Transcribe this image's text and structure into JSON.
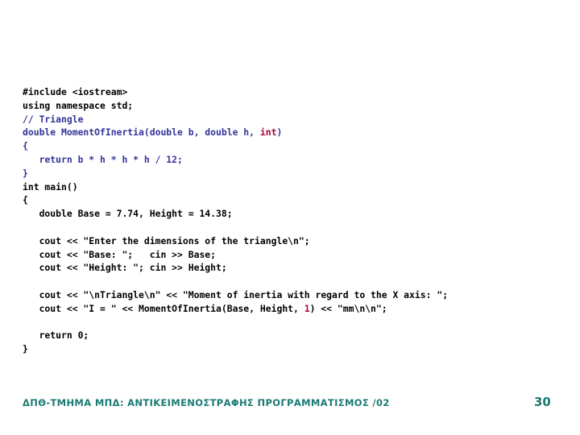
{
  "slide": {
    "background_color": "#ffffff",
    "page_number": "30",
    "footer_text": "ΔΠΘ-ΤΜΗΜΑ ΜΠΔ: ΑΝΤΙΚΕΙΜΕΝΟΣΤΡΑΦΗΣ ΠΡΟΓΡΑΜΜΑΤΙΣΜΟΣ /02",
    "footer_color": "#1a7a73"
  },
  "colors": {
    "plain": "#000000",
    "keyword_navy": "#333399",
    "comment": "#333399",
    "literal_red": "#aa0033",
    "accent_teal": "#1a7a73"
  },
  "code": {
    "language": "cpp",
    "lines": [
      {
        "id": "line-1",
        "segments": [
          {
            "text": "#include <iostream>",
            "style": "plain"
          }
        ]
      },
      {
        "id": "line-2",
        "segments": [
          {
            "text": "using namespace std;",
            "style": "plain"
          }
        ]
      },
      {
        "id": "line-3",
        "segments": [
          {
            "text": "// Triangle",
            "style": "comment"
          }
        ]
      },
      {
        "id": "line-4",
        "segments": [
          {
            "text": "double MomentOfInertia(double b, double h, ",
            "style": "navy"
          },
          {
            "text": "int",
            "style": "red"
          },
          {
            "text": ")",
            "style": "navy"
          }
        ]
      },
      {
        "id": "line-5",
        "segments": [
          {
            "text": "{",
            "style": "navy"
          }
        ]
      },
      {
        "id": "line-6",
        "segments": [
          {
            "text": "   return b * h * h * h / 12;",
            "style": "navy"
          }
        ]
      },
      {
        "id": "line-7",
        "segments": [
          {
            "text": "}",
            "style": "navy"
          }
        ]
      },
      {
        "id": "line-8",
        "segments": [
          {
            "text": "int main()",
            "style": "plain"
          }
        ]
      },
      {
        "id": "line-9",
        "segments": [
          {
            "text": "{",
            "style": "plain"
          }
        ]
      },
      {
        "id": "line-10",
        "segments": [
          {
            "text": "   double Base = 7.74, Height = 14.38;",
            "style": "plain"
          }
        ]
      },
      {
        "id": "line-11",
        "segments": [
          {
            "text": "",
            "style": "plain"
          }
        ]
      },
      {
        "id": "line-12",
        "segments": [
          {
            "text": "   cout << \"Enter the dimensions of the triangle\\n\";",
            "style": "plain"
          }
        ]
      },
      {
        "id": "line-13",
        "segments": [
          {
            "text": "   cout << \"Base: \";   cin >> Base;",
            "style": "plain"
          }
        ]
      },
      {
        "id": "line-14",
        "segments": [
          {
            "text": "   cout << \"Height: \"; cin >> Height;",
            "style": "plain"
          }
        ]
      },
      {
        "id": "line-15",
        "segments": [
          {
            "text": "",
            "style": "plain"
          }
        ]
      },
      {
        "id": "line-16",
        "segments": [
          {
            "text": "   cout << \"\\nTriangle\\n\" << \"Moment of inertia with regard to the X axis: \";",
            "style": "plain"
          }
        ]
      },
      {
        "id": "line-17",
        "segments": [
          {
            "text": "   cout << \"I = \" << MomentOfInertia(Base, Height, ",
            "style": "plain"
          },
          {
            "text": "1",
            "style": "red"
          },
          {
            "text": ") << \"mm\\n\\n\";",
            "style": "plain"
          }
        ]
      },
      {
        "id": "line-18",
        "segments": [
          {
            "text": "",
            "style": "plain"
          }
        ]
      },
      {
        "id": "line-19",
        "segments": [
          {
            "text": "   return 0;",
            "style": "plain"
          }
        ]
      },
      {
        "id": "line-20",
        "segments": [
          {
            "text": "}",
            "style": "plain"
          }
        ]
      }
    ]
  }
}
